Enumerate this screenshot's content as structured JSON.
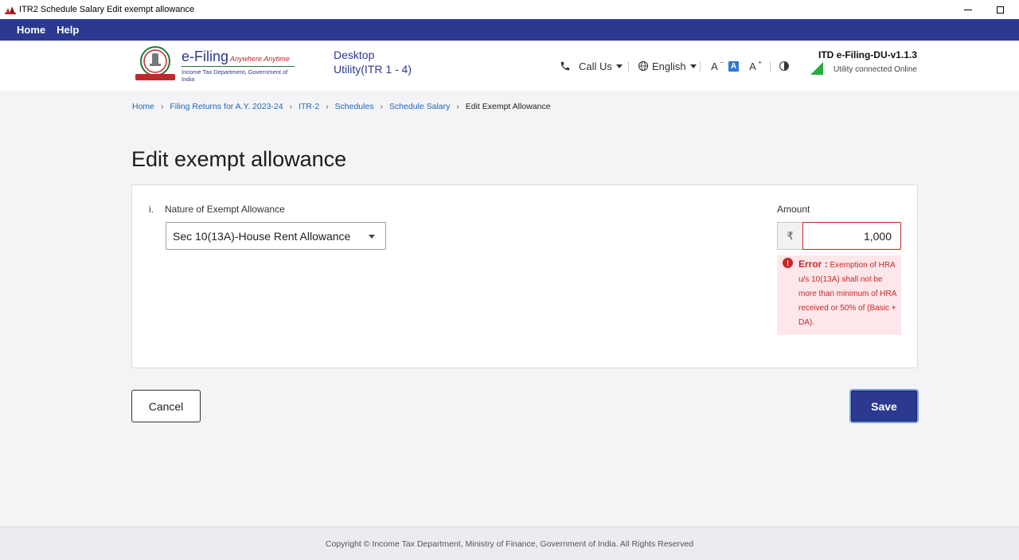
{
  "window": {
    "title": "ITR2 Schedule Salary Edit exempt allowance"
  },
  "navbar": {
    "home_label": "Home",
    "help_label": "Help"
  },
  "header": {
    "logo_main": "e-Filing",
    "logo_tagline": "Anywhere Anytime",
    "logo_subtitle": "Income Tax Department, Government of India",
    "desktop_line1": "Desktop",
    "desktop_line2": "Utility(ITR 1 - 4)",
    "call_us_label": "Call Us",
    "language_label": "English",
    "font_decrease": "A",
    "font_normal": "A",
    "font_increase": "A",
    "version": "ITD e-Filing-DU-v1.1.3",
    "connection_status": "Utility connected Online"
  },
  "breadcrumb": {
    "items": [
      "Home",
      "Filing Returns for A.Y. 2023-24",
      "ITR-2",
      "Schedules",
      "Schedule Salary"
    ],
    "current": "Edit Exempt Allowance"
  },
  "page": {
    "title": "Edit exempt allowance"
  },
  "form": {
    "row_index": "i.",
    "nature_label": "Nature of Exempt Allowance",
    "nature_selected": "Sec 10(13A)-House Rent Allowance",
    "amount_label": "Amount",
    "currency_symbol": "₹",
    "amount_value": "1,000",
    "error_prefix": "Error :",
    "error_message": "Exemption of HRA u/s 10(13A) shall not be more than minimum of HRA received or 50% of (Basic + DA)."
  },
  "buttons": {
    "cancel_label": "Cancel",
    "save_label": "Save"
  },
  "footer": {
    "copyright": "Copyright © Income Tax Department, Ministry of Finance, Government of India. All Rights Reserved"
  },
  "colors": {
    "primary": "#2b3990",
    "error": "#c62828",
    "link": "#1f66b3",
    "online": "#27ae3e"
  },
  "icons": {
    "call": "phone-icon",
    "language": "globe-icon",
    "contrast": "contrast-icon",
    "signal": "signal-icon",
    "error": "error-icon",
    "dropdown": "chevron-down-icon"
  }
}
